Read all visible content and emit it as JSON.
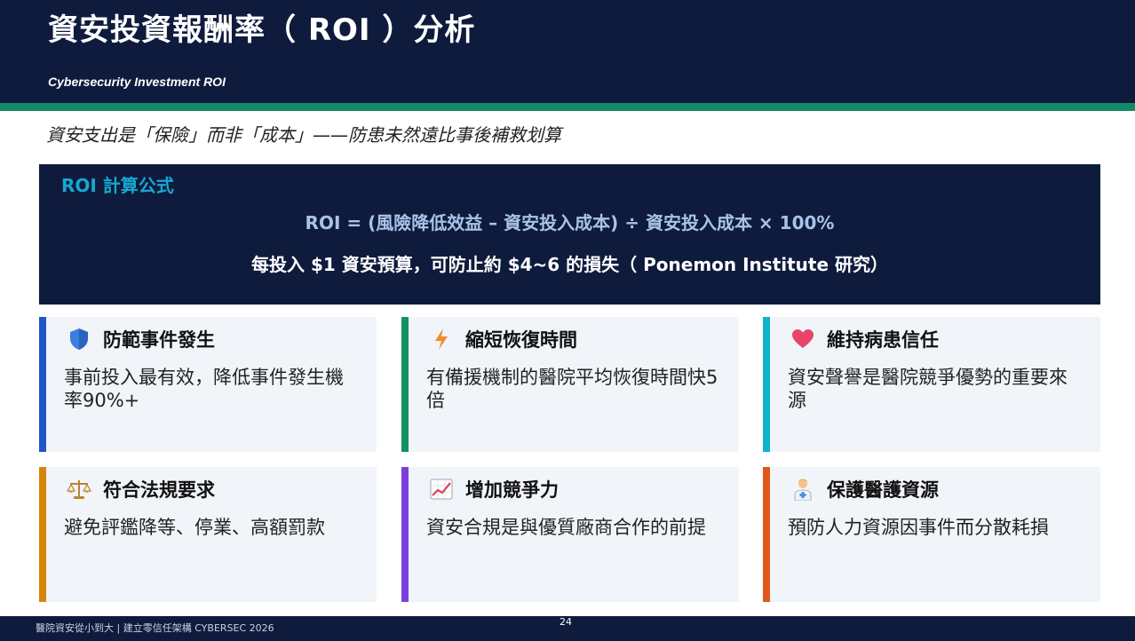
{
  "slide": {
    "title": "資安投資報酬率（ ROI ）分析",
    "subtitle": "Cybersecurity Investment ROI",
    "tagline": "資安支出是「保險」而非「成本」——防患未然遠比事後補救划算"
  },
  "formula": {
    "heading": "ROI 計算公式",
    "equation": "ROI = (風險降低效益 – 資安投入成本) ÷ 資安投入成本 × 100%",
    "note": "每投入 $1 資安預算，可防止約 $4~6 的損失（ Ponemon Institute 研究）"
  },
  "cards": [
    {
      "icon": "shield-icon",
      "title": "防範事件發生",
      "body": "事前投入最有效，降低事件發生機率90%+",
      "color": "#1f56c8"
    },
    {
      "icon": "lightning-icon",
      "title": "縮短恢復時間",
      "body": "有備援機制的醫院平均恢復時間快5倍",
      "color": "#0f9460"
    },
    {
      "icon": "heart-icon",
      "title": "維持病患信任",
      "body": "資安聲譽是醫院競爭優勢的重要來源",
      "color": "#10b3c9"
    },
    {
      "icon": "scales-icon",
      "title": "符合法規要求",
      "body": "避免評鑑降等、停業、高額罰款",
      "color": "#d7850b"
    },
    {
      "icon": "chart-increasing-icon",
      "title": "增加競爭力",
      "body": "資安合規是與優質廠商合作的前提",
      "color": "#7b3fe0"
    },
    {
      "icon": "health-worker-icon",
      "title": "保護醫護資源",
      "body": "預防人力資源因事件而分散耗損",
      "color": "#e0571b"
    }
  ],
  "footer": {
    "text": "醫院資安從小到大 | 建立零信任架構   CYBERSEC 2026",
    "page_number": "24"
  }
}
